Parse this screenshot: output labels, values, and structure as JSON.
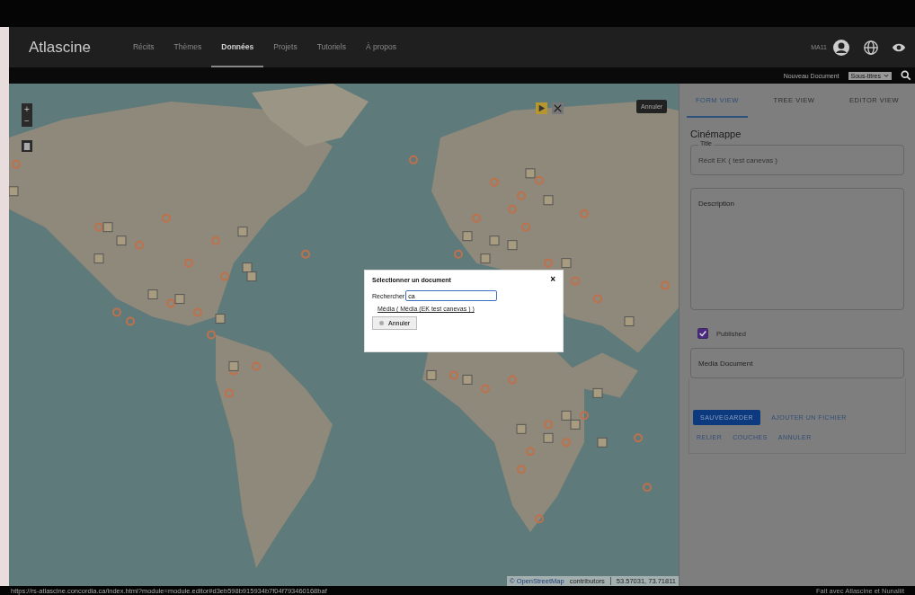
{
  "navbar": {
    "logo": "Atlascine",
    "items": [
      {
        "label": "Récits",
        "selected": false
      },
      {
        "label": "Thèmes",
        "selected": false
      },
      {
        "label": "Données",
        "selected": true
      },
      {
        "label": "Projets",
        "selected": false
      },
      {
        "label": "Tutoriels",
        "selected": false
      },
      {
        "label": "À propos",
        "selected": false
      }
    ],
    "user": "MA11"
  },
  "subbar": {
    "new_document": "Nouveau Document",
    "select": "Sous-titres"
  },
  "map": {
    "kind": "picture",
    "zoom_in": "+",
    "zoom_out": "−",
    "cancel": "Annuler",
    "attribution_link": "© OpenStreetMap",
    "attribution": "contributors",
    "coordinates": "53.57031, 73.71811"
  },
  "dialog": {
    "title": "Sélectionner un document",
    "close": "×",
    "search_label": "Rechercher",
    "search_value": "ca",
    "result": "Média ( Média (EK test canevas ) )",
    "cancel": "Annuler"
  },
  "panel": {
    "tabs": [
      {
        "label": "FORM VIEW",
        "selected": true
      },
      {
        "label": "TREE VIEW",
        "selected": false
      },
      {
        "label": "EDITOR VIEW",
        "selected": false
      }
    ],
    "heading": "Cinémappe",
    "title_label": "Title",
    "title_value": "Récit EK ( test canevas )",
    "description_placeholder": "Description",
    "published_label": "Published",
    "published": true,
    "media_placeholder": "Media Document",
    "buttons": [
      {
        "label": "SAUVEGARDER",
        "kind": "primary"
      },
      {
        "label": "AJOUTER UN FICHIER",
        "kind": "text"
      }
    ],
    "links": [
      "RELIER",
      "COUCHES",
      "ANNULER"
    ]
  },
  "status_bar": {
    "url": "https://rs-atlascine.concordia.ca/index.html?module=module.editor#d3eb598b915934b7f04f793460168baf",
    "credit": "Fait avec Atlascine et Nunaliit"
  }
}
